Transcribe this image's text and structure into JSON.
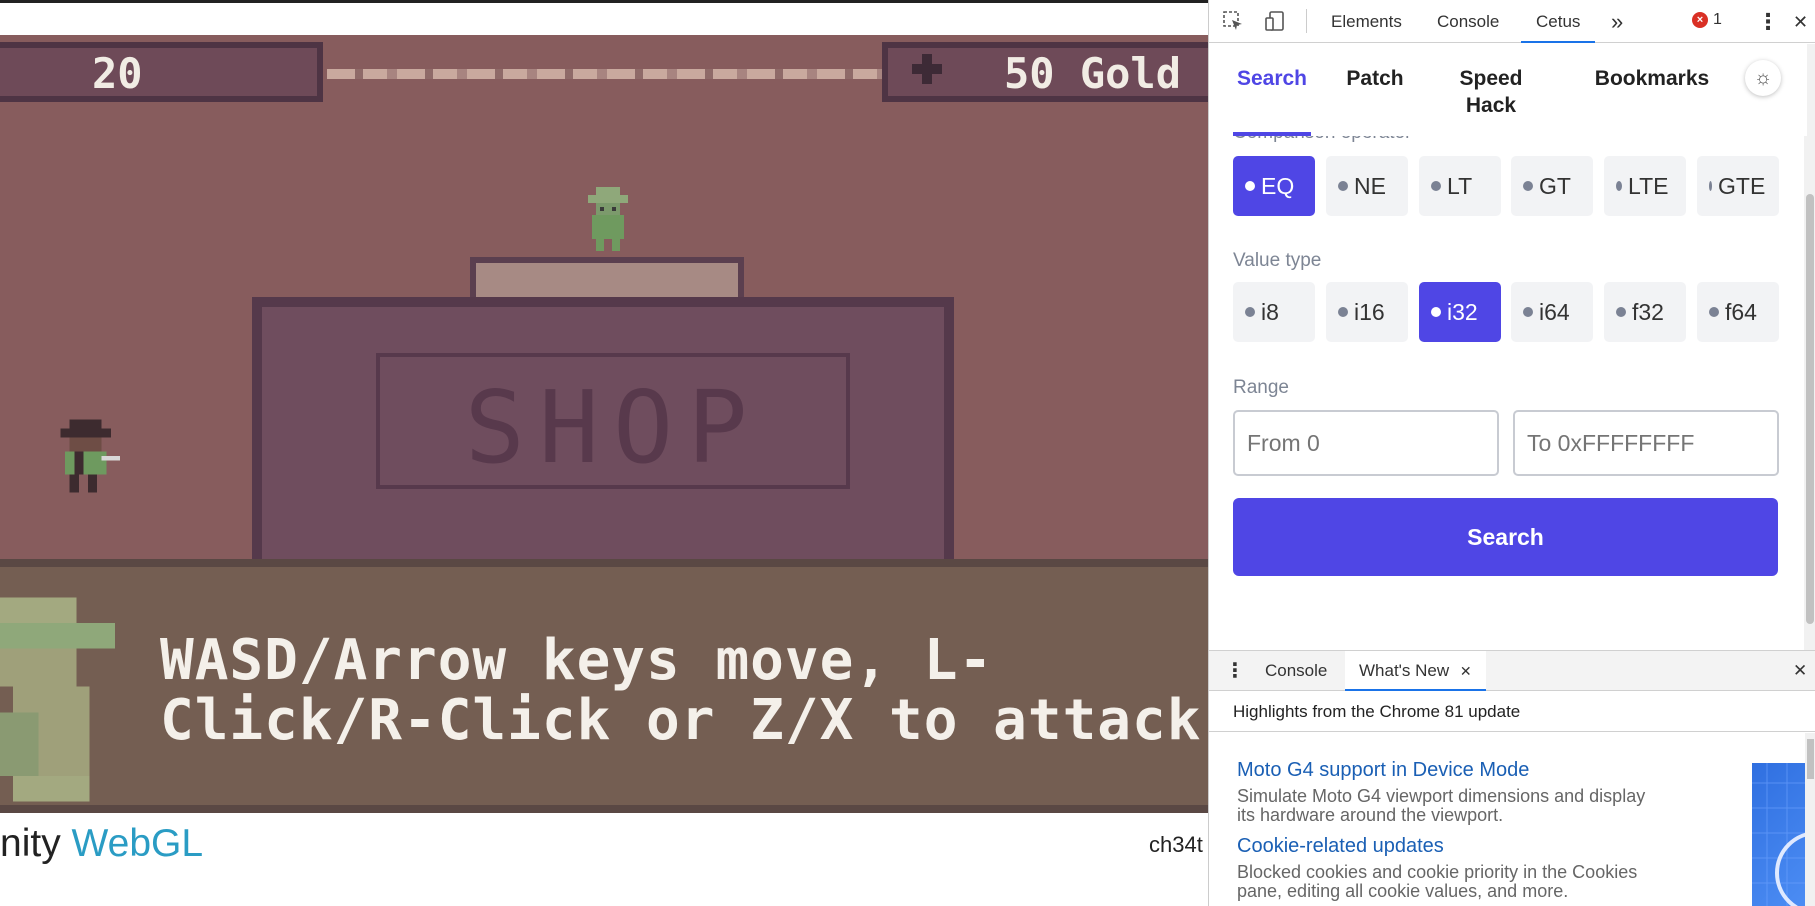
{
  "game": {
    "hud_left_value": "20",
    "hud_gold": "50 Gold",
    "hud_gold_icon": "plus-icon",
    "shop_sign": "SHOP",
    "dialog_text": "WASD/Arrow keys move, L-\nClick/R-Click or Z/X to attack",
    "footer_logo_prefix": "nity ",
    "footer_logo_brand": "WebGL",
    "footer_title": "ch34t"
  },
  "devtools": {
    "toolbar_icons": [
      "inspect-icon",
      "device-toggle-icon"
    ],
    "tabs": [
      {
        "label": "Elements",
        "active": false
      },
      {
        "label": "Console",
        "active": false
      },
      {
        "label": "Cetus",
        "active": true
      }
    ],
    "more_tabs": "»",
    "error_badge": "×",
    "error_count": "1",
    "kebab": "⋮",
    "close": "✕"
  },
  "cetus": {
    "nav": [
      {
        "label": "Search",
        "active": true
      },
      {
        "label": "Patch",
        "active": false
      },
      {
        "label": "Speed\nHack",
        "active": false
      },
      {
        "label": "Bookmarks",
        "active": false
      }
    ],
    "theme_icon": "☼",
    "comparison_label": "Comparison operator",
    "comparison_options": [
      {
        "label": "EQ",
        "active": true
      },
      {
        "label": "NE",
        "active": false
      },
      {
        "label": "LT",
        "active": false
      },
      {
        "label": "GT",
        "active": false
      },
      {
        "label": "LTE",
        "active": false
      },
      {
        "label": "GTE",
        "active": false
      }
    ],
    "value_type_label": "Value type",
    "value_type_options": [
      {
        "label": "i8",
        "active": false
      },
      {
        "label": "i16",
        "active": false
      },
      {
        "label": "i32",
        "active": true
      },
      {
        "label": "i64",
        "active": false
      },
      {
        "label": "f32",
        "active": false
      },
      {
        "label": "f64",
        "active": false
      }
    ],
    "range_label": "Range",
    "range_from_placeholder": "From 0",
    "range_to_placeholder": "To 0xFFFFFFFF",
    "search_button": "Search",
    "accent_color": "#4f46e5"
  },
  "drawer": {
    "kebab": "⋮",
    "tabs": [
      {
        "label": "Console",
        "active": false
      },
      {
        "label": "What's New",
        "active": true
      }
    ],
    "tab_close": "✕",
    "close": "✕",
    "header": "Highlights from the Chrome 81 update",
    "items": [
      {
        "title": "Moto G4 support in Device Mode",
        "description": "Simulate Moto G4 viewport dimensions and display its hardware around the viewport."
      },
      {
        "title": "Cookie-related updates",
        "description": "Blocked cookies and cookie priority in the Cookies pane, editing all cookie values, and more."
      }
    ]
  }
}
